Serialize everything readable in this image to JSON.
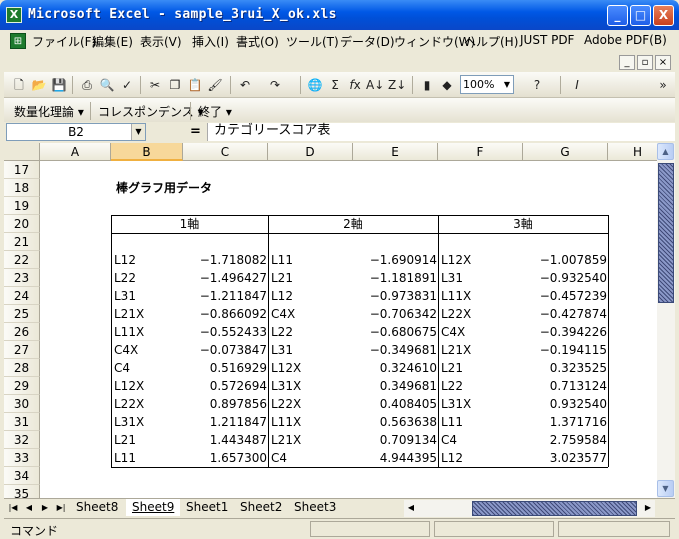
{
  "window": {
    "title": "Microsoft Excel - sample_3rui_X_ok.xls",
    "min_label": "_",
    "max_label": "□",
    "close_label": "X"
  },
  "menu": {
    "items": [
      "ファイル(F)",
      "編集(E)",
      "表示(V)",
      "挿入(I)",
      "書式(O)",
      "ツール(T)",
      "データ(D)",
      "ウィンドウ(W)",
      "ヘルプ(H)",
      "JUST PDF",
      "Adobe PDF(B)"
    ]
  },
  "toolbar": {
    "zoom": "100%"
  },
  "toolbar2": {
    "items": [
      "数量化理論 ▾",
      "コレスポンデンス ▾",
      "終了 ▾"
    ]
  },
  "formula": {
    "namebox": "B2",
    "eq": "=",
    "content": "カテゴリースコア表"
  },
  "columns": [
    "A",
    "B",
    "C",
    "D",
    "E",
    "F",
    "G",
    "H"
  ],
  "rows": [
    "17",
    "18",
    "19",
    "20",
    "21",
    "22",
    "23",
    "24",
    "25",
    "26",
    "27",
    "28",
    "29",
    "30",
    "31",
    "32",
    "33",
    "34",
    "35"
  ],
  "sheet_title": "棒グラフ用データ",
  "axis_headers": [
    "1軸",
    "2軸",
    "3軸"
  ],
  "table": [
    [
      "L12",
      "-1.718082",
      "L11",
      "-1.690914",
      "L12X",
      "-1.007859"
    ],
    [
      "L22",
      "-1.496427",
      "L21",
      "-1.181891",
      "L31",
      "-0.932540"
    ],
    [
      "L31",
      "-1.211847",
      "L12",
      "-0.973831",
      "L11X",
      "-0.457239"
    ],
    [
      "L21X",
      "-0.866092",
      "C4X",
      "-0.706342",
      "L22X",
      "-0.427874"
    ],
    [
      "L11X",
      "-0.552433",
      "L22",
      "-0.680675",
      "C4X",
      "-0.394226"
    ],
    [
      "C4X",
      "-0.073847",
      "L31",
      "-0.349681",
      "L21X",
      "-0.194115"
    ],
    [
      "C4",
      "0.516929",
      "L12X",
      "0.324610",
      "L21",
      "0.323525"
    ],
    [
      "L12X",
      "0.572694",
      "L31X",
      "0.349681",
      "L22",
      "0.713124"
    ],
    [
      "L22X",
      "0.897856",
      "L22X",
      "0.408405",
      "L31X",
      "0.932540"
    ],
    [
      "L31X",
      "1.211847",
      "L11X",
      "0.563638",
      "L11",
      "1.371716"
    ],
    [
      "L21",
      "1.443487",
      "L21X",
      "0.709134",
      "C4",
      "2.759584"
    ],
    [
      "L11",
      "1.657300",
      "C4",
      "4.944395",
      "L12",
      "3.023577"
    ]
  ],
  "sheets": [
    "Sheet8",
    "Sheet9",
    "Sheet1",
    "Sheet2",
    "Sheet3"
  ],
  "active_sheet": "Sheet9",
  "status": "コマンド"
}
